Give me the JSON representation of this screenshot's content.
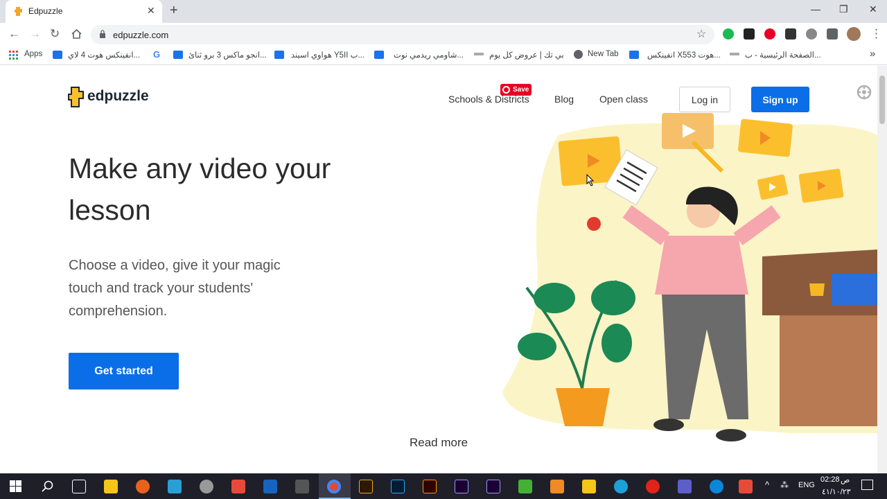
{
  "browser": {
    "tab_title": "Edpuzzle",
    "url": "edpuzzle.com",
    "bookmarks": [
      "Apps",
      "انفينكس هوت 4 لاي...",
      "انجو ماكس 3 برو ثنائ...",
      "هواوي اسيند Y5II ب...",
      "شاومي ريدمي نوت...",
      "بي تك | عروض كل يوم",
      "New Tab",
      "انفينكس X553 هوت...",
      "الصفحة الرئيسية - ب..."
    ],
    "more_bookmarks": "»"
  },
  "site": {
    "logo": "edpuzzle",
    "nav": {
      "schools": "Schools & Districts",
      "blog": "Blog",
      "open_class": "Open class",
      "login": "Log in",
      "signup": "Sign up"
    },
    "pinterest_save": "Save",
    "headline": "Make any video your lesson",
    "subtext": "Choose a video, give it your magic touch and track your students' comprehension.",
    "cta": "Get started",
    "read_more": "Read more"
  },
  "taskbar": {
    "lang": "ENG",
    "time": "02:28",
    "ampm": "ص",
    "date": "٤١/١٠/٢٣"
  },
  "colors": {
    "brand_blue": "#0a6ee8",
    "brand_yellow": "#fbbf2e",
    "pinterest_red": "#e60023"
  }
}
